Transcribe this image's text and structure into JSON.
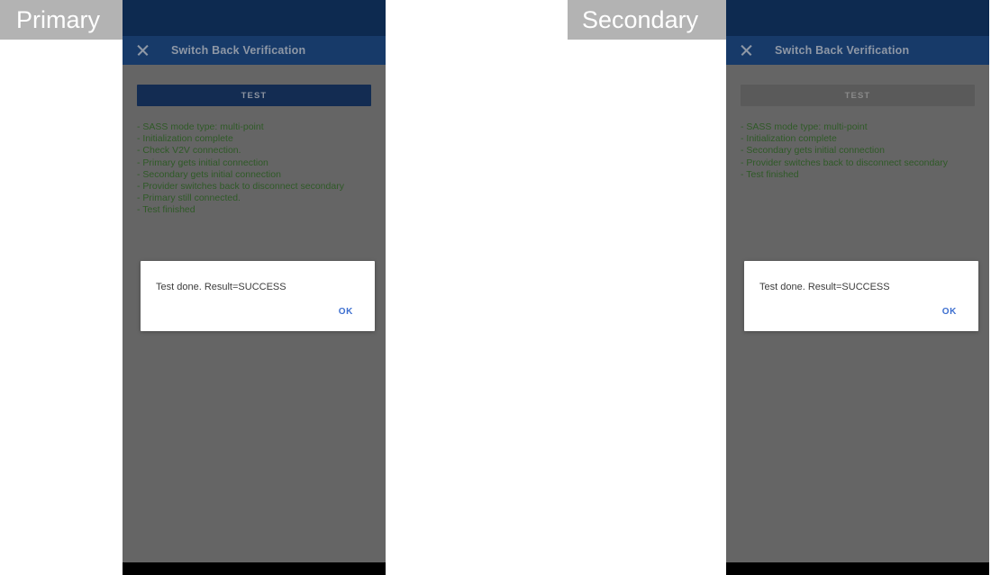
{
  "captions": {
    "primary": "Primary",
    "secondary": "Secondary"
  },
  "colors": {
    "status_bar": "#0d2a50",
    "toolbar": "#173a69",
    "scrim": "#656565",
    "test_button_enabled": "#132c52",
    "test_button_disabled": "#5a5a5a",
    "log_text": "#2f5a27",
    "dialog_action": "#3d6fd0",
    "caption_badge": "#b3b3b3",
    "nav_bar": "#000000"
  },
  "devices": [
    {
      "id": "primary",
      "toolbar": {
        "close_icon": "close-icon",
        "title": "Switch Back Verification"
      },
      "test_button": {
        "label": "TEST",
        "enabled": true
      },
      "log_lines": [
        "- SASS mode type: multi-point",
        "- Initialization complete",
        "- Check V2V connection.",
        "- Primary gets initial connection",
        "- Secondary gets initial connection",
        "- Provider switches back to disconnect secondary",
        "- Primary still connected.",
        "- Test finished"
      ],
      "dialog": {
        "message": "Test done. Result=SUCCESS",
        "ok_label": "OK"
      }
    },
    {
      "id": "secondary",
      "toolbar": {
        "close_icon": "close-icon",
        "title": "Switch Back Verification"
      },
      "test_button": {
        "label": "TEST",
        "enabled": false
      },
      "log_lines": [
        "- SASS mode type: multi-point",
        "- Initialization complete",
        "- Secondary gets initial connection",
        "- Provider switches back to disconnect secondary",
        "- Test finished"
      ],
      "dialog": {
        "message": "Test done. Result=SUCCESS",
        "ok_label": "OK"
      }
    }
  ]
}
